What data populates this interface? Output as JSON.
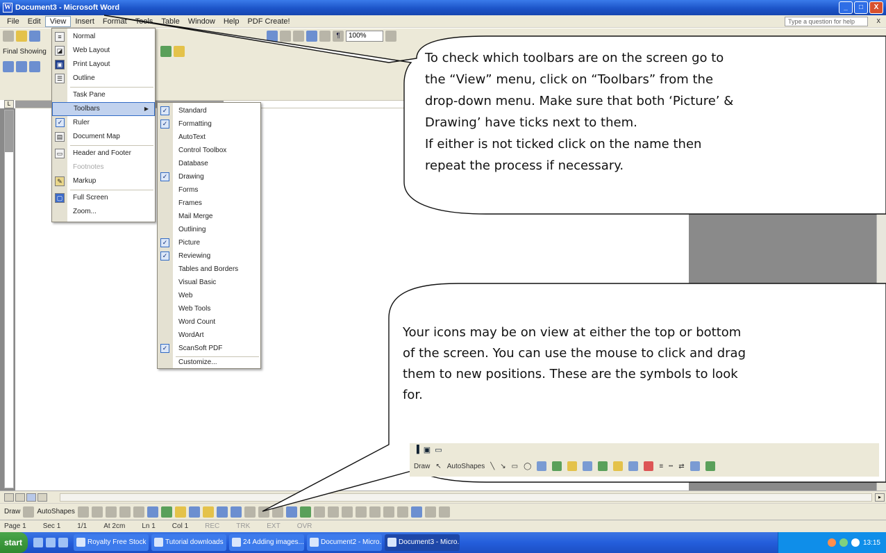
{
  "window": {
    "title": "Document3 - Microsoft Word",
    "minimize": "_",
    "maximize": "□",
    "close": "X"
  },
  "menubar": {
    "items": [
      "File",
      "Edit",
      "View",
      "Insert",
      "Format",
      "Tools",
      "Table",
      "Window",
      "Help",
      "PDF Create!"
    ],
    "ask_placeholder": "Type a question for help",
    "ask_close": "x"
  },
  "toolbar": {
    "zoom": "100%",
    "find_showing": "Final Showing"
  },
  "view_menu": {
    "items": [
      {
        "label": "Normal",
        "icon": "normal-view-icon"
      },
      {
        "label": "Web Layout",
        "icon": "web-layout-icon"
      },
      {
        "label": "Print Layout",
        "icon": "print-layout-icon"
      },
      {
        "label": "Outline",
        "icon": "outline-icon"
      },
      {
        "label": "Task Pane"
      },
      {
        "label": "Toolbars",
        "highlighted": true,
        "submenu": true
      },
      {
        "label": "Ruler",
        "checked": true
      },
      {
        "label": "Document Map",
        "icon": "document-map-icon"
      },
      {
        "label": "Header and Footer",
        "icon": "header-footer-icon"
      },
      {
        "label": "Footnotes",
        "disabled": true
      },
      {
        "label": "Markup",
        "icon": "markup-icon"
      },
      {
        "label": "Full Screen",
        "icon": "full-screen-icon"
      },
      {
        "label": "Zoom..."
      }
    ]
  },
  "toolbars_submenu": {
    "items": [
      {
        "label": "Standard",
        "checked": true
      },
      {
        "label": "Formatting",
        "checked": true
      },
      {
        "label": "AutoText",
        "checked": false
      },
      {
        "label": "Control Toolbox",
        "checked": false
      },
      {
        "label": "Database",
        "checked": false
      },
      {
        "label": "Drawing",
        "checked": true
      },
      {
        "label": "Forms",
        "checked": false
      },
      {
        "label": "Frames",
        "checked": false
      },
      {
        "label": "Mail Merge",
        "checked": false
      },
      {
        "label": "Outlining",
        "checked": false
      },
      {
        "label": "Picture",
        "checked": true
      },
      {
        "label": "Reviewing",
        "checked": true
      },
      {
        "label": "Tables and Borders",
        "checked": false
      },
      {
        "label": "Visual Basic",
        "checked": false
      },
      {
        "label": "Web",
        "checked": false
      },
      {
        "label": "Web Tools",
        "checked": false
      },
      {
        "label": "Word Count",
        "checked": false
      },
      {
        "label": "WordArt",
        "checked": false
      },
      {
        "label": "ScanSoft PDF",
        "checked": true
      },
      {
        "label": "Customize...",
        "checked": false
      }
    ]
  },
  "callouts": {
    "top": [
      "To check which toolbars are on the screen go to",
      "the “View” menu, click on “Toolbars” from the",
      "drop-down menu.  Make sure that both ‘Picture’ &",
      "Drawing’ have ticks next to them.",
      "If either is not ticked click on the name then",
      "repeat the process if necessary."
    ],
    "bottom": [
      "Your icons may be on view at either the top or bottom",
      "of the screen.  You can use the mouse to click and drag",
      "them to new positions.  These are the symbols to look",
      "for."
    ]
  },
  "toolbar_image": {
    "draw_label": "Draw",
    "autoshapes_label": "AutoShapes"
  },
  "drawing_toolbar": {
    "draw": "Draw",
    "autoshapes": "AutoShapes"
  },
  "statusbar": {
    "page": "Page 1",
    "sec": "Sec 1",
    "pages": "1/1",
    "at": "At 2cm",
    "ln": "Ln 1",
    "col": "Col 1",
    "rec": "REC",
    "trk": "TRK",
    "ext": "EXT",
    "ovr": "OVR"
  },
  "taskbar": {
    "start": "start",
    "tasks": [
      "Royalty Free Stock P...",
      "Tutorial downloads",
      "24 Adding images...",
      "Document2 - Micro...",
      "Document3 - Micro..."
    ],
    "clock": "13:15"
  }
}
